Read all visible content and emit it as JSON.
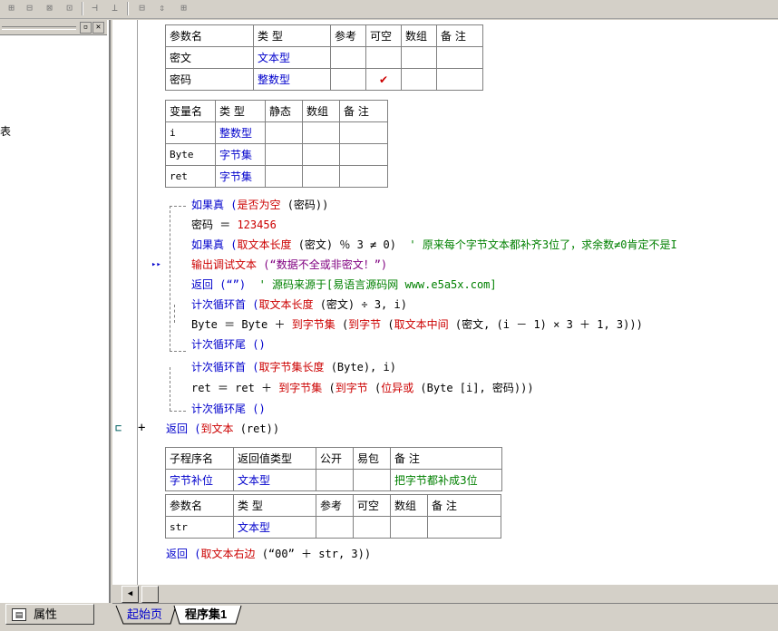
{
  "toolbar": {
    "buttons": [
      "⊞",
      "⊟",
      "⊠",
      "⊡",
      "⊣",
      "⊥",
      "⊟",
      "⇕",
      "⊞"
    ]
  },
  "left_panel": {
    "min_btn": "▫",
    "close_btn": "✕",
    "partial_char": "表",
    "properties_tab": "属性"
  },
  "params_table": {
    "headers": [
      "参数名",
      "类 型",
      "参考",
      "可空",
      "数组",
      "备 注"
    ],
    "rows": [
      [
        "密文",
        "文本型",
        "",
        "",
        "",
        ""
      ],
      [
        "密码",
        "整数型",
        "",
        "✔",
        "",
        ""
      ]
    ]
  },
  "vars_table": {
    "headers": [
      "变量名",
      "类 型",
      "静态",
      "数组",
      "备 注"
    ],
    "rows": [
      [
        "i",
        "整数型",
        "",
        "",
        ""
      ],
      [
        "Byte",
        "字节集",
        "",
        "",
        ""
      ],
      [
        "ret",
        "字节集",
        "",
        "",
        ""
      ]
    ]
  },
  "code": {
    "l1": [
      "如果真 (",
      "是否为空",
      " (密码))"
    ],
    "l2": [
      "密码 ＝ ",
      "123456"
    ],
    "l3": [
      "如果真 (",
      "取文本长度",
      " (密文) ％ 3 ≠ 0)  ",
      "' 原来每个字节文本都补齐3位了，求余数≠0肯定不是I"
    ],
    "l4": [
      "输出调试文本",
      " (“数据不全或非密文！”)"
    ],
    "l5": [
      "返回 (“”)  ",
      "' 源码来源于[易语言源码网 www.e5a5x.com]"
    ],
    "l6": [
      "计次循环首 (",
      "取文本长度",
      " (密文) ÷ 3, i)"
    ],
    "l7": [
      "Byte ＝ Byte ＋ ",
      "到字节集",
      " (",
      "到字节",
      " (",
      "取文本中间",
      " (密文, (i － 1) × 3 ＋ 1, 3)))"
    ],
    "l8": [
      "计次循环尾 ()"
    ],
    "l9": [
      "计次循环首 (",
      "取字节集长度",
      " (Byte), i)"
    ],
    "l10": [
      "ret ＝ ret ＋ ",
      "到字节集",
      " (",
      "到字节",
      " (",
      "位异或",
      " (Byte [i], 密码)))"
    ],
    "l11": [
      "计次循环尾 ()"
    ],
    "l12": [
      "返回 (",
      "到文本",
      " (ret))"
    ]
  },
  "sub_table": {
    "headers": [
      "子程序名",
      "返回值类型",
      "公开",
      "易包",
      "备 注"
    ],
    "row": [
      "字节补位",
      "文本型",
      "",
      "",
      "把字节都补成3位"
    ]
  },
  "sub_params_table": {
    "headers": [
      "参数名",
      "类 型",
      "参考",
      "可空",
      "数组",
      "备 注"
    ],
    "rows": [
      [
        "str",
        "文本型",
        "",
        "",
        "",
        ""
      ]
    ]
  },
  "code2": {
    "l1": [
      "返回 (",
      "取文本右边",
      " (“00” ＋ str, 3))"
    ]
  },
  "tabs": {
    "start": "起始页",
    "program": "程序集1"
  },
  "gutter": {
    "marker": "▸▸",
    "plus": "+"
  }
}
